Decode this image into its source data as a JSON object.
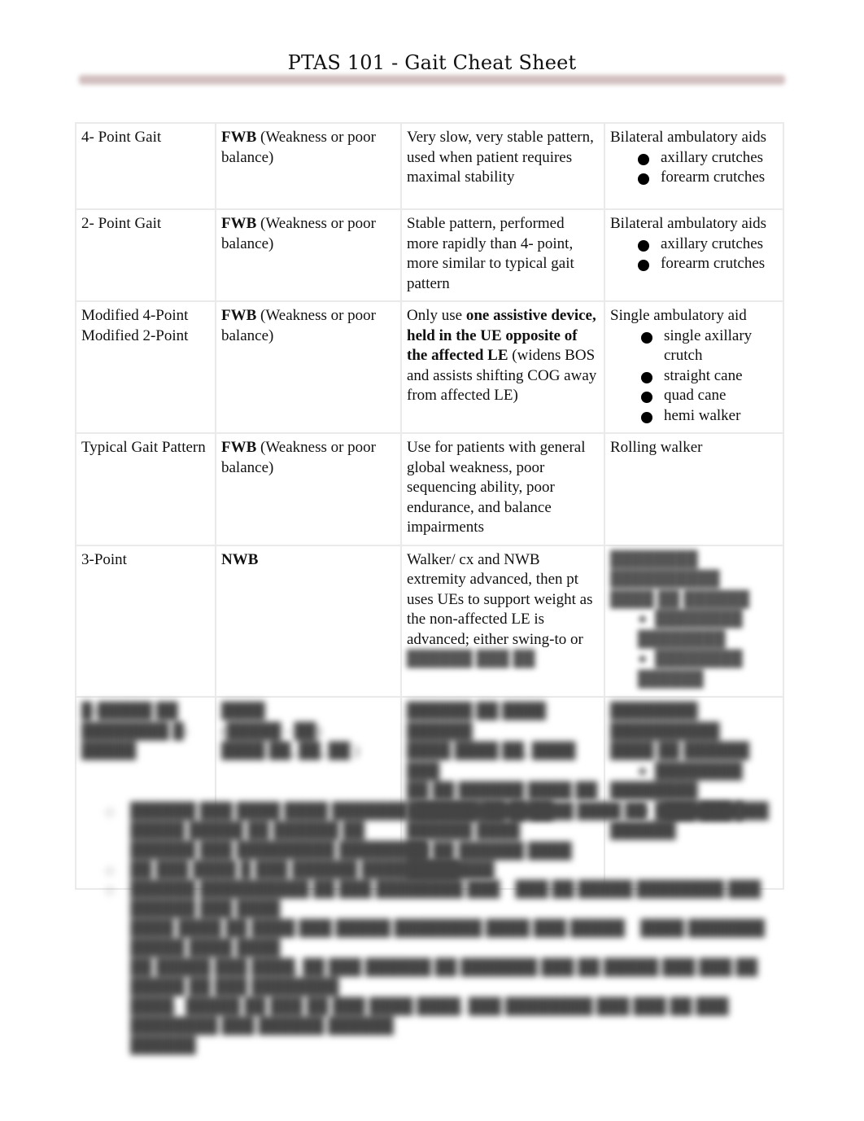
{
  "document": {
    "title": "PTAS 101 - Gait Cheat Sheet",
    "accent_rule_color": "#d2bfbf"
  },
  "table": {
    "rows": [
      {
        "pattern": "4- Point Gait",
        "weight_bearing_bold": "FWB",
        "weight_bearing_rest": " (Weakness or poor balance)",
        "description": "Very slow, very stable pattern, used when patient requires maximal stability",
        "device_heading": "Bilateral ambulatory aids",
        "devices": [
          "axillary crutches",
          "forearm crutches"
        ]
      },
      {
        "pattern": "2- Point Gait",
        "weight_bearing_bold": "FWB",
        "weight_bearing_rest": " (Weakness or poor balance)",
        "description": "Stable pattern, performed more rapidly than 4- point, more similar to typical gait pattern",
        "device_heading": "Bilateral ambulatory aids",
        "devices": [
          "axillary crutches",
          "forearm crutches"
        ]
      },
      {
        "pattern_line1": "Modified 4-Point",
        "pattern_line2": "Modified 2-Point",
        "weight_bearing_bold": "FWB",
        "weight_bearing_rest": " (Weakness or poor balance)",
        "description_pre": "Only use ",
        "description_bold": "one assistive device, held in the UE opposite of the affected LE",
        "description_post": " (widens BOS and assists shifting COG away from affected LE)",
        "device_heading": "Single ambulatory aid",
        "devices": [
          "single axillary crutch",
          "straight cane",
          "quad cane",
          "hemi walker"
        ]
      },
      {
        "pattern": "Typical Gait Pattern",
        "weight_bearing_bold": "FWB",
        "weight_bearing_rest": " (Weakness or poor balance)",
        "description": "Use for patients with general global weakness, poor sequencing ability, poor endurance, and balance impairments",
        "device_heading": "Rolling walker",
        "devices": []
      },
      {
        "pattern": "3-Point",
        "weight_bearing_bold": "NWB",
        "weight_bearing_rest": "",
        "description": "Walker/ cx and NWB extremity advanced, then pt uses UEs to support weight as the non-affected LE is advanced; either swing-to or",
        "description_obscured": "[obscured]",
        "device_obscured": true
      },
      {
        "obscured": true
      }
    ]
  },
  "notes": {
    "obscured": true,
    "item_count": 4
  }
}
